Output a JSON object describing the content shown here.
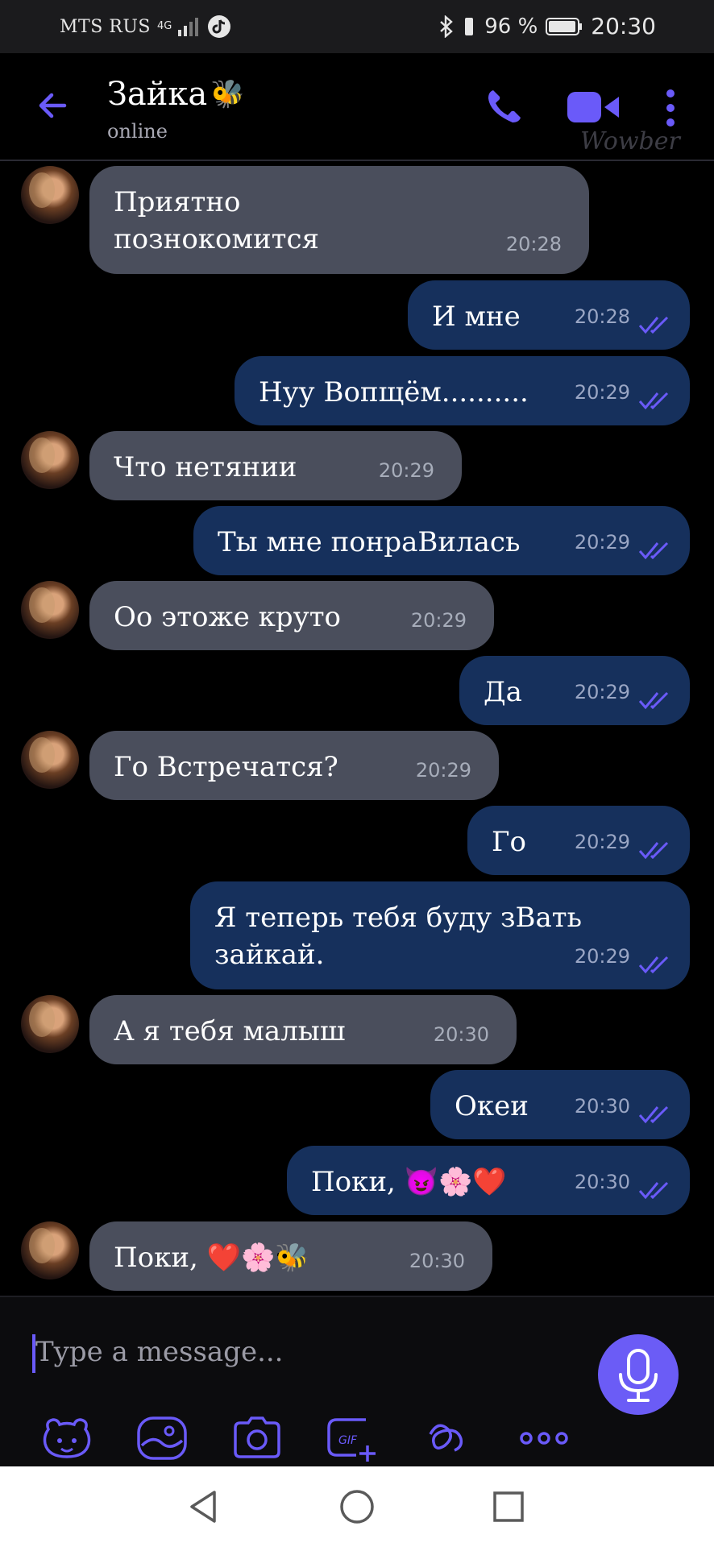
{
  "status_bar": {
    "carrier": "MTS RUS",
    "network": "4G",
    "battery": "96 %",
    "time": "20:30"
  },
  "header": {
    "contact_name": "Зайка",
    "contact_emoji": "🐝",
    "status": "online",
    "watermark": "Wowber"
  },
  "messages": [
    {
      "dir": "in",
      "lines": [
        "Приятно",
        "познокомится"
      ],
      "time": "20:28"
    },
    {
      "dir": "out",
      "lines": [
        "И мне"
      ],
      "time": "20:28"
    },
    {
      "dir": "out",
      "lines": [
        "Нуу Вопщём.........."
      ],
      "time": "20:29"
    },
    {
      "dir": "in",
      "lines": [
        "Что нетянии"
      ],
      "time": "20:29"
    },
    {
      "dir": "out",
      "lines": [
        "Ты мне понраВилась"
      ],
      "time": "20:29"
    },
    {
      "dir": "in",
      "lines": [
        "Оо этоже круто"
      ],
      "time": "20:29"
    },
    {
      "dir": "out",
      "lines": [
        "Да"
      ],
      "time": "20:29"
    },
    {
      "dir": "in",
      "lines": [
        "Го Встречатся?"
      ],
      "time": "20:29"
    },
    {
      "dir": "out",
      "lines": [
        "Го"
      ],
      "time": "20:29"
    },
    {
      "dir": "out",
      "lines": [
        "Я теперь тебя буду зВать",
        "зайкай."
      ],
      "time": "20:29"
    },
    {
      "dir": "in",
      "lines": [
        "А я тебя малыш"
      ],
      "time": "20:30"
    },
    {
      "dir": "out",
      "lines": [
        "Океи"
      ],
      "time": "20:30"
    },
    {
      "dir": "out",
      "lines": [
        "Поки, 😈🌸❤️"
      ],
      "time": "20:30"
    },
    {
      "dir": "in",
      "lines": [
        "Поки, ❤️🌸🐝"
      ],
      "time": "20:30"
    }
  ],
  "composer": {
    "placeholder": "Type a message..."
  },
  "toolbar_icons": [
    "sticker-icon",
    "gallery-icon",
    "camera-icon",
    "gif-icon",
    "doodle-icon",
    "more-icon"
  ],
  "colors": {
    "incoming_bubble": "#4a4e5c",
    "outgoing_bubble": "#16305c",
    "accent": "#6b5cf6"
  }
}
